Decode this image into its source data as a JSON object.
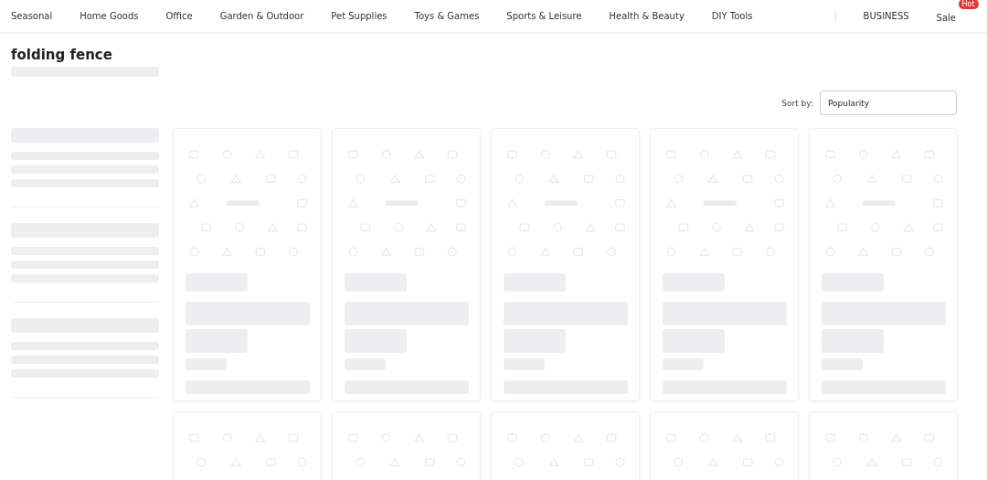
{
  "nav": {
    "categories": [
      "Seasonal",
      "Home Goods",
      "Office",
      "Garden & Outdoor",
      "Pet Supplies",
      "Toys & Games",
      "Sports & Leisure",
      "Health & Beauty",
      "DIY Tools"
    ],
    "business": "BUSINESS",
    "sale": {
      "label": "Sale",
      "badge": "Hot"
    }
  },
  "search": {
    "query": "folding fence"
  },
  "sort": {
    "label": "Sort by:",
    "value": "Popularity"
  }
}
